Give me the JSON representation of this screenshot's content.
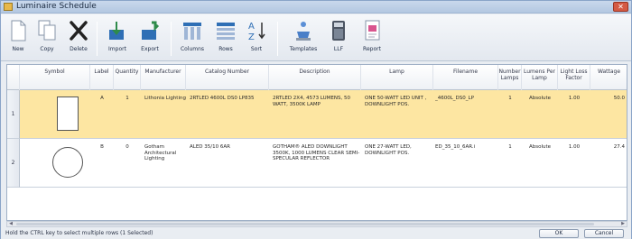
{
  "window": {
    "title": "Luminaire Schedule",
    "close_glyph": "✕"
  },
  "toolbar": {
    "new": "New",
    "copy": "Copy",
    "delete": "Delete",
    "import": "Import",
    "export": "Export",
    "columns": "Columns",
    "rows": "Rows",
    "sort": "Sort",
    "templates": "Templates",
    "llf": "LLF",
    "report": "Report"
  },
  "columns": {
    "symbol": "Symbol",
    "label": "Label",
    "quantity": "Quantity",
    "manufacturer": "Manufacturer",
    "catalog": "Catalog Number",
    "description": "Description",
    "lamp": "Lamp",
    "filename": "Filename",
    "number_lamps": "Number Lamps",
    "lumens_per_lamp": "Lumens Per Lamp",
    "llf": "Light Loss Factor",
    "wattage": "Wattage"
  },
  "rows": [
    {
      "num": "1",
      "symbol_icon": "rectangle-symbol-icon",
      "label": "A",
      "quantity": "1",
      "manufacturer": "Lithonia Lighting",
      "catalog": "2RTLED 4600L DS0 LP835",
      "description": "2RTLED 2X4, 4573 LUMENS, 50 WATT, 3500K LAMP",
      "lamp": "ONE 50-WATT LED UNIT , DOWNLIGHT POS.",
      "filename": "_4600L_DS0_LP",
      "number_lamps": "1",
      "lumens_per_lamp": "Absolute",
      "llf": "1.00",
      "wattage": "50.0",
      "selected": true
    },
    {
      "num": "2",
      "symbol_icon": "circle-symbol-icon",
      "label": "B",
      "quantity": "0",
      "manufacturer": "Gotham Architectural Lighting",
      "catalog": "ALED 35/10 6AR",
      "description": "GOTHAM® ALED DOWNLIGHT 3500K, 1000 LUMENS CLEAR SEMI-SPECULAR REFLECTOR",
      "lamp": "ONE 27-WATT LED, DOWNLIGHT POS.",
      "filename": "ED_35_10_6AR.i",
      "number_lamps": "1",
      "lumens_per_lamp": "Absolute",
      "llf": "1.00",
      "wattage": "27.4",
      "selected": false
    }
  ],
  "status": {
    "text": "Hold the CTRL key to select multiple rows (1 Selected)"
  },
  "buttons": {
    "ok": "OK",
    "cancel": "Cancel"
  },
  "colors": {
    "selected_row": "#fde6a2",
    "title_bar": "#b3c7e1",
    "accent_blue": "#2f6fb5",
    "accent_green": "#2e8b4a"
  }
}
